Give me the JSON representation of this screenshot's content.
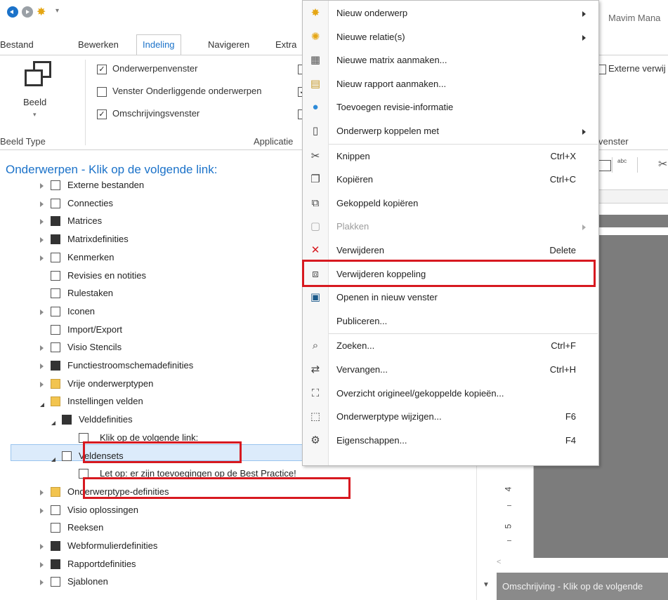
{
  "app_title": "Mavim Mana",
  "menu_tabs": [
    "Bestand",
    "Bewerken",
    "Indeling",
    "Navigeren",
    "Extra"
  ],
  "ribbon": {
    "beeld_label": "Beeld",
    "group_beeld_type": "Beeld Type",
    "group_applicatie": "Applicatie",
    "group_venster": "venster",
    "checkboxes": [
      {
        "label": "Onderwerpenvenster",
        "checked": true
      },
      {
        "label": "Venster Onderliggende onderwerpen",
        "checked": false
      },
      {
        "label": "Omschrijvingsvenster",
        "checked": true
      }
    ],
    "externe_label": "Externe verwij"
  },
  "tree": {
    "title": "Onderwerpen - Klik op de volgende link:",
    "items": [
      {
        "label": "Externe bestanden",
        "icon": "external-files-icon"
      },
      {
        "label": "Connecties",
        "icon": "connections-icon"
      },
      {
        "label": "Matrices",
        "icon": "matrix-icon"
      },
      {
        "label": "Matrixdefinities",
        "icon": "matrix-definition-icon"
      },
      {
        "label": "Kenmerken",
        "icon": "attributes-icon"
      },
      {
        "label": "Revisies en notities",
        "icon": "revision-icon"
      },
      {
        "label": "Rulestaken",
        "icon": "rules-icon"
      },
      {
        "label": "Iconen",
        "icon": "icons-icon"
      },
      {
        "label": "Import/Export",
        "icon": "import-export-icon"
      },
      {
        "label": "Visio Stencils",
        "icon": "visio-stencil-icon"
      },
      {
        "label": "Functiestroomschemadefinities",
        "icon": "flowchart-icon"
      },
      {
        "label": "Vrije onderwerptypen",
        "icon": "folder-icon"
      },
      {
        "label": "Instellingen velden",
        "icon": "settings-fields-icon"
      },
      {
        "label": "Velddefinities",
        "icon": "field-definition-icon"
      },
      {
        "label": "Klik op de volgende link:",
        "icon": "field-icon"
      },
      {
        "label": "Veldensets",
        "icon": "fieldset-icon"
      },
      {
        "label": "Let op: er zijn toevoegingen op de Best Practice!",
        "icon": "fieldset-item-icon"
      },
      {
        "label": "Onderwerptype-definities",
        "icon": "topic-type-icon"
      },
      {
        "label": "Visio oplossingen",
        "icon": "visio-solution-icon"
      },
      {
        "label": "Reeksen",
        "icon": "series-icon"
      },
      {
        "label": "Webformulierdefinities",
        "icon": "webform-icon"
      },
      {
        "label": "Rapportdefinities",
        "icon": "report-icon"
      },
      {
        "label": "Sjablonen",
        "icon": "template-icon"
      }
    ]
  },
  "context_menu": [
    {
      "label": "Nieuw onderwerp",
      "shortcut": "",
      "submenu": true,
      "icon": "new-topic-icon",
      "disabled": false
    },
    {
      "label": "Nieuwe relatie(s)",
      "shortcut": "",
      "submenu": true,
      "icon": "new-relation-icon",
      "disabled": false
    },
    {
      "label": "Nieuwe matrix aanmaken...",
      "shortcut": "",
      "submenu": false,
      "icon": "new-matrix-icon",
      "disabled": false
    },
    {
      "label": "Nieuw rapport aanmaken...",
      "shortcut": "",
      "submenu": false,
      "icon": "new-report-icon",
      "disabled": false
    },
    {
      "label": "Toevoegen revisie-informatie",
      "shortcut": "",
      "submenu": false,
      "icon": "revision-info-icon",
      "disabled": false
    },
    {
      "label": "Onderwerp koppelen met",
      "shortcut": "",
      "submenu": true,
      "icon": "link-topic-icon",
      "disabled": false
    },
    {
      "label": "Knippen",
      "shortcut": "Ctrl+X",
      "submenu": false,
      "icon": "cut-icon",
      "disabled": false
    },
    {
      "label": "Kopiëren",
      "shortcut": "Ctrl+C",
      "submenu": false,
      "icon": "copy-icon",
      "disabled": false
    },
    {
      "label": "Gekoppeld kopiëren",
      "shortcut": "",
      "submenu": false,
      "icon": "linked-copy-icon",
      "disabled": false
    },
    {
      "label": "Plakken",
      "shortcut": "",
      "submenu": true,
      "icon": "paste-icon",
      "disabled": true
    },
    {
      "label": "Verwijderen",
      "shortcut": "Delete",
      "submenu": false,
      "icon": "delete-icon",
      "disabled": false
    },
    {
      "label": "Verwijderen koppeling",
      "shortcut": "",
      "submenu": false,
      "icon": "remove-link-icon",
      "disabled": false
    },
    {
      "label": "Openen in nieuw venster",
      "shortcut": "",
      "submenu": false,
      "icon": "open-window-icon",
      "disabled": false
    },
    {
      "label": "Publiceren...",
      "shortcut": "",
      "submenu": false,
      "icon": "",
      "disabled": false
    },
    {
      "label": "Zoeken...",
      "shortcut": "Ctrl+F",
      "submenu": false,
      "icon": "search-icon",
      "disabled": false
    },
    {
      "label": "Vervangen...",
      "shortcut": "Ctrl+H",
      "submenu": false,
      "icon": "replace-icon",
      "disabled": false
    },
    {
      "label": "Overzicht origineel/gekoppelde kopieën...",
      "shortcut": "",
      "submenu": false,
      "icon": "overview-icon",
      "disabled": false
    },
    {
      "label": "Onderwerptype wijzigen...",
      "shortcut": "F6",
      "submenu": false,
      "icon": "change-type-icon",
      "disabled": false
    },
    {
      "label": "Eigenschappen...",
      "shortcut": "F4",
      "submenu": false,
      "icon": "gear-icon",
      "disabled": false
    }
  ],
  "ruler_labels": [
    "4",
    "5"
  ],
  "description_bar": "Omschrijving - Klik op de volgende",
  "colors": {
    "accent": "#1b72c9",
    "highlight": "#d71920",
    "selection": "#dcebfb"
  }
}
